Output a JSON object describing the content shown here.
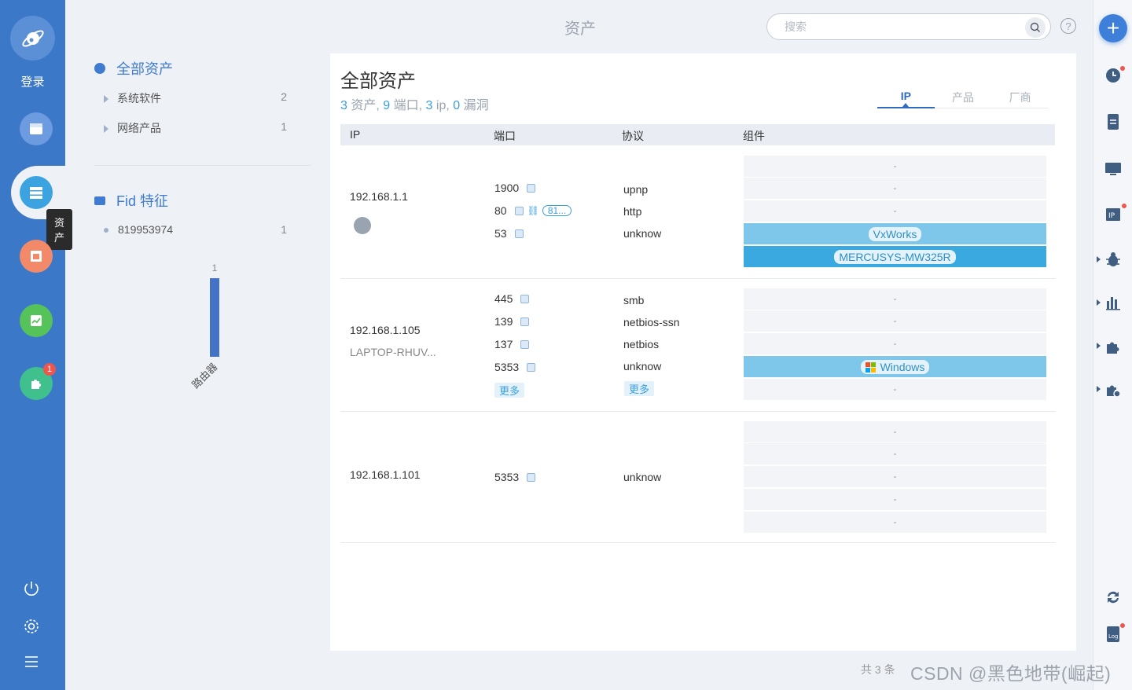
{
  "sidebar": {
    "login_label": "登录",
    "tooltip": "资产",
    "apps_badge": "1",
    "icons": [
      "planet-logo-icon",
      "dashboard-icon",
      "assets-icon",
      "report-icon",
      "chart-icon",
      "puzzle-icon",
      "power-icon",
      "settings-icon",
      "menu-icon"
    ]
  },
  "header": {
    "title": "资产",
    "search_placeholder": "搜索",
    "help": "?"
  },
  "filter": {
    "all_assets": "全部资产",
    "categories": [
      {
        "label": "系统软件",
        "count": "2"
      },
      {
        "label": "网络产品",
        "count": "1"
      }
    ],
    "fid_title": "Fid 特征",
    "fid_items": [
      {
        "label": "819953974",
        "count": "1"
      }
    ],
    "chart": {
      "value": "1",
      "category": "路由器"
    }
  },
  "chart_data": {
    "type": "bar",
    "categories": [
      "路由器"
    ],
    "values": [
      1
    ]
  },
  "main": {
    "title": "全部资产",
    "summary": {
      "assets": "3",
      "assets_label": "资产",
      "ports": "9",
      "ports_label": "端口",
      "ips": "3",
      "ips_label": "ip",
      "vulns": "0",
      "vulns_label": "漏洞"
    },
    "tabs": [
      "IP",
      "产品",
      "厂商"
    ],
    "columns": [
      "IP",
      "端口",
      "协议",
      "组件"
    ],
    "rows": [
      {
        "ip": "192.168.1.1",
        "host": "",
        "ports": [
          "1900",
          "80",
          "53"
        ],
        "port_link": "81...",
        "protocols": [
          "upnp",
          "http",
          "unknow"
        ],
        "components": [
          "-",
          "-",
          "-",
          "VxWorks",
          "MERCUSYS-MW325R"
        ]
      },
      {
        "ip": "192.168.1.105",
        "host": "LAPTOP-RHUV...",
        "ports": [
          "445",
          "139",
          "137",
          "5353"
        ],
        "protocols": [
          "smb",
          "netbios-ssn",
          "netbios",
          "unknow"
        ],
        "more": "更多",
        "components": [
          "-",
          "-",
          "-",
          "Windows",
          "-"
        ]
      },
      {
        "ip": "192.168.1.101",
        "host": "",
        "ports": [
          "5353"
        ],
        "protocols": [
          "unknow"
        ],
        "components": [
          "-",
          "-",
          "-",
          "-",
          "-"
        ]
      }
    ]
  },
  "footer": {
    "total": "共 3 条"
  },
  "watermark": "CSDN @黑色地带(崛起)",
  "colors": {
    "sidebar": "#3b78c8",
    "accent": "#3aa0dc",
    "highlight_light": "#7fc7ea",
    "highlight_dark": "#3aa9e0"
  }
}
